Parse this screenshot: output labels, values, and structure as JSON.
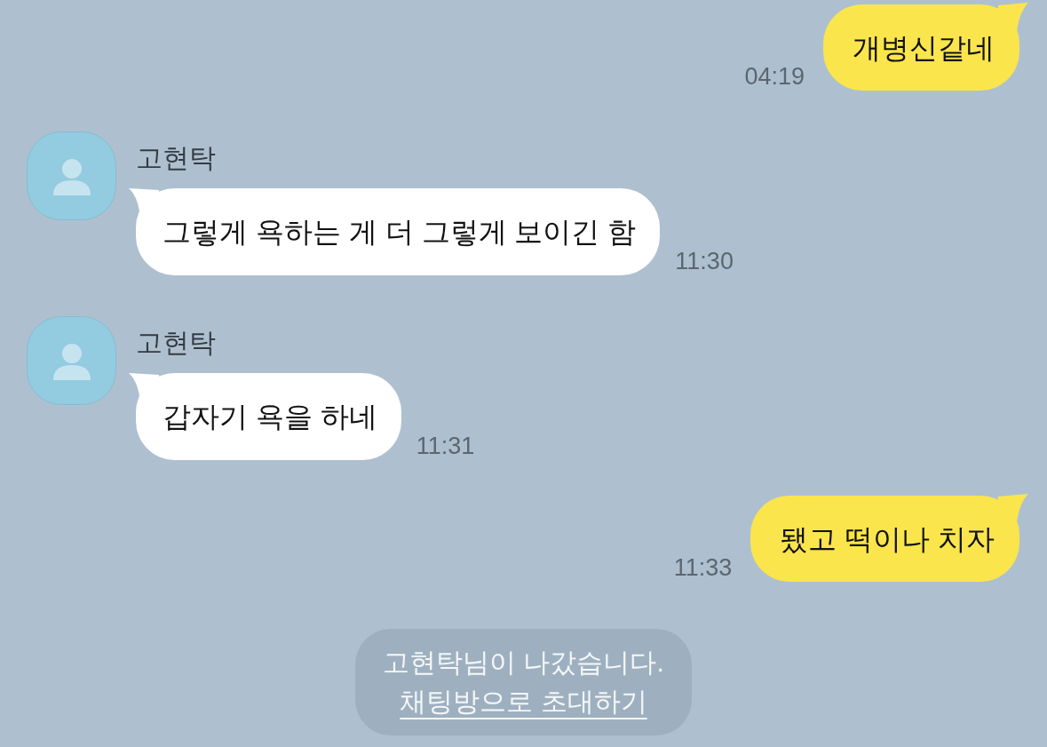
{
  "messages": [
    {
      "kind": "outgoing",
      "text": "개병신같네",
      "time": "04:19"
    },
    {
      "kind": "incoming",
      "sender": "고현탁",
      "text": "그렇게 욕하는 게 더 그렇게 보이긴 함",
      "time": "11:30"
    },
    {
      "kind": "incoming",
      "sender": "고현탁",
      "text": "갑자기 욕을 하네",
      "time": "11:31"
    },
    {
      "kind": "outgoing",
      "text": "됐고 떡이나 치자",
      "time": "11:33"
    }
  ],
  "system_notice": {
    "text": "고현탁님이 나갔습니다.",
    "link": "채팅방으로 초대하기"
  }
}
